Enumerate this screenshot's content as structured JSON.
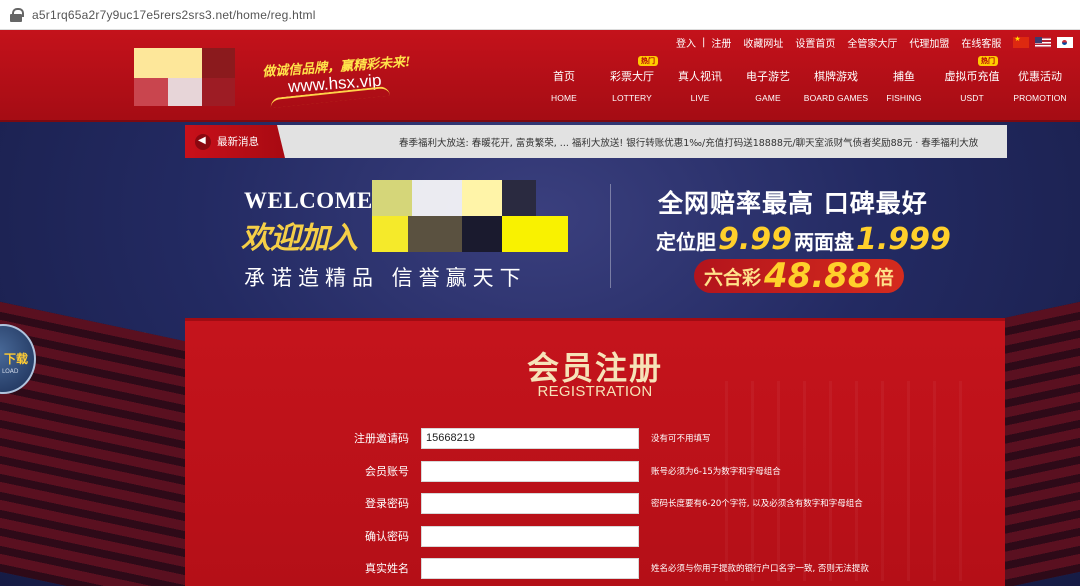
{
  "browser": {
    "url": "a5r1rq65a2r7y9uc17e5rers2srs3.net/home/reg.html"
  },
  "header": {
    "slogan": "做诚信品牌，赢精彩未来!",
    "site_url": "www.hsx.vip",
    "top_links": [
      "登入",
      "注册",
      "收藏网址",
      "设置首页",
      "全管家大厅",
      "代理加盟",
      "在线客服"
    ],
    "separator": "|",
    "nav": [
      {
        "cn": "首页",
        "en": "HOME",
        "badge": ""
      },
      {
        "cn": "彩票大厅",
        "en": "LOTTERY",
        "badge": "热门"
      },
      {
        "cn": "真人视讯",
        "en": "LIVE",
        "badge": ""
      },
      {
        "cn": "电子游艺",
        "en": "GAME",
        "badge": ""
      },
      {
        "cn": "棋牌游戏",
        "en": "BOARD GAMES",
        "badge": ""
      },
      {
        "cn": "捕鱼",
        "en": "FISHING",
        "badge": ""
      },
      {
        "cn": "虚拟币充值",
        "en": "USDT",
        "badge": "热门"
      },
      {
        "cn": "优惠活动",
        "en": "PROMOTION",
        "badge": ""
      }
    ]
  },
  "ticker": {
    "label": "最新消息",
    "text": "春季福利大放送:      春暖花开, 富贵繁荣,     ...     福利大放送! 银行转账优惠1‰/充值打码送18888元/聊天室派财气债者奖励88元 · 春季福利大放"
  },
  "banner": {
    "welcome": "WELCOME",
    "join": "欢迎加入",
    "promise": "承诺造精品 信誉赢天下",
    "odds_title": "全网赔率最高 口碑最好",
    "odds_a_label": "定位胆",
    "odds_a_value": "9.99",
    "odds_b_label": "两面盘",
    "odds_b_value": "1.999",
    "odds_c_label": "六合彩",
    "odds_c_value": "48.88",
    "odds_c_unit": "倍"
  },
  "download": {
    "cn": "下载",
    "en": "LOAD"
  },
  "registration": {
    "title": "会员注册",
    "subtitle": "REGISTRATION",
    "fields": [
      {
        "label": "注册邀请码",
        "value": "15668219",
        "hint": "没有可不用填写"
      },
      {
        "label": "会员账号",
        "value": "",
        "hint": "账号必须为6-15为数字和字母组合"
      },
      {
        "label": "登录密码",
        "value": "",
        "hint": "密码长度要有6-20个字符, 以及必须含有数字和字母组合"
      },
      {
        "label": "确认密码",
        "value": "",
        "hint": ""
      },
      {
        "label": "真实姓名",
        "value": "",
        "hint": "姓名必须与你用于提款的银行户口名字一致, 否则无法提款"
      }
    ]
  },
  "colors": {
    "header_red": "#c4121b",
    "gold": "#ffd02b",
    "panel_red": "#c5141c"
  }
}
